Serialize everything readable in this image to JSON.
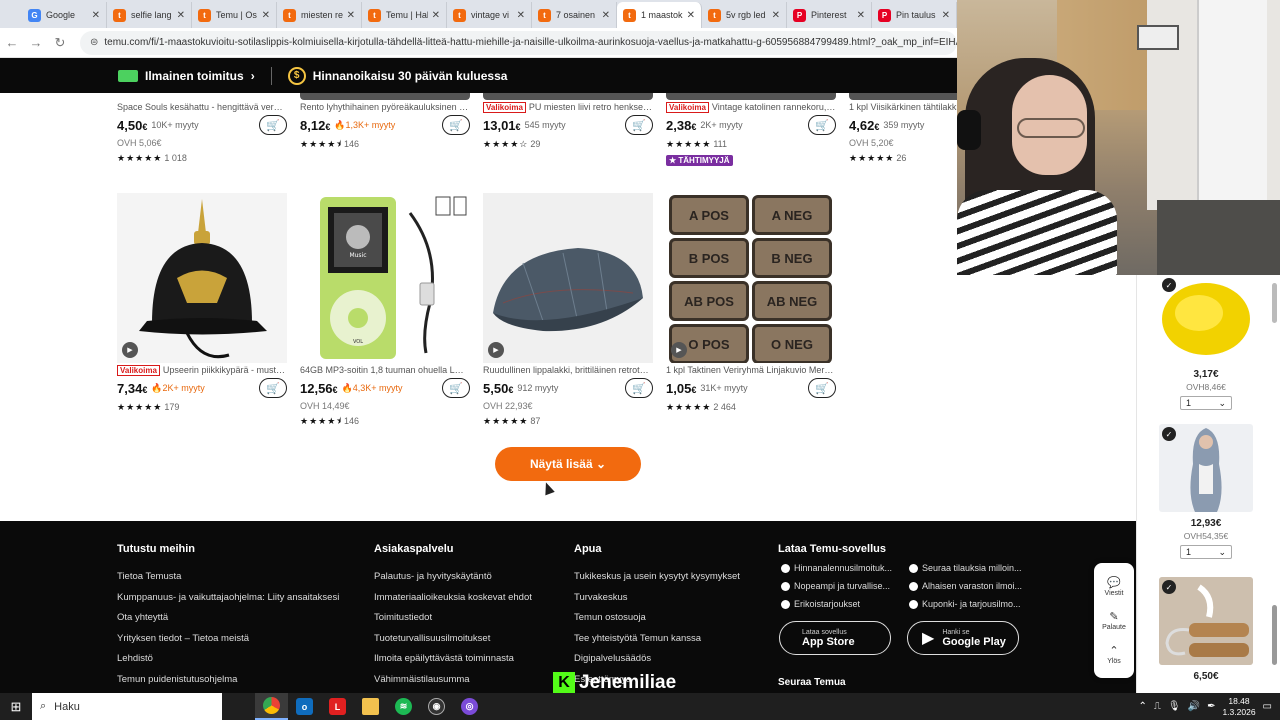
{
  "browser": {
    "tabs": [
      {
        "label": "Google",
        "fav": "G",
        "color": "#4285f4"
      },
      {
        "label": "selfie lang",
        "fav": "t",
        "color": "#f26a0f"
      },
      {
        "label": "Temu | Os",
        "fav": "t",
        "color": "#f26a0f"
      },
      {
        "label": "miesten re",
        "fav": "t",
        "color": "#f26a0f"
      },
      {
        "label": "Temu | Hal",
        "fav": "t",
        "color": "#f26a0f"
      },
      {
        "label": "vintage vi",
        "fav": "t",
        "color": "#f26a0f"
      },
      {
        "label": "7 osainen",
        "fav": "t",
        "color": "#f26a0f"
      },
      {
        "label": "1 maastok",
        "fav": "t",
        "color": "#f26a0f",
        "active": true
      },
      {
        "label": "5v rgb led",
        "fav": "t",
        "color": "#f26a0f"
      },
      {
        "label": "Pinterest",
        "fav": "P",
        "color": "#e60023"
      },
      {
        "label": "Pin taulus",
        "fav": "P",
        "color": "#e60023"
      }
    ],
    "url": "temu.com/fi/1-maastokuvioitu-sotilaslippis-kolmiuisella-kirjotulla-tähdellä-litteä-hattu-miehille-ja-naisille-ulkoilma-aurinkosuoja-vaellus-ja-matkahattu-g-605956884799489.html?_oak_mp_inf=EIHA%2BKbV4"
  },
  "promo": {
    "shipping": "Ilmainen toimitus",
    "shipping_arrow": "›",
    "price_adjust": "Hinnanoikaisu 30 päivän kuluessa",
    "coin": "$"
  },
  "row1": [
    {
      "title": "Space Souls kesähattu - hengittävä verkko...",
      "price_int": "4,50",
      "cur": "€",
      "sold": "10K+ myyty",
      "hot": false,
      "orig": "OVH 5,06€",
      "stars": "★★★★★",
      "count": "1 018",
      "badge": "",
      "star_badge": ""
    },
    {
      "title": "Rento lyhythihainen pyöreäkauluksinen t-p...",
      "price_int": "8,12",
      "cur": "€",
      "sold": "🔥1,3K+ myyty",
      "hot": true,
      "orig": "",
      "stars": "★★★★⯨",
      "count": "146",
      "badge": "",
      "star_badge": ""
    },
    {
      "title": "PU miesten liivi retro henkselit...",
      "price_int": "13,01",
      "cur": "€",
      "sold": "545 myyty",
      "hot": false,
      "orig": "",
      "stars": "★★★★☆",
      "count": "29",
      "badge": "Valikoima",
      "star_badge": ""
    },
    {
      "title": "Vintage katolinen rannekoru, s...",
      "price_int": "2,38",
      "cur": "€",
      "sold": "2K+ myyty",
      "hot": false,
      "orig": "",
      "stars": "★★★★★",
      "count": "111",
      "badge": "Valikoima",
      "star_badge": "★ TÄHTIMYYJÄ"
    },
    {
      "title": "1 kpl Viisikärkinen tähtilakki,...",
      "price_int": "4,62",
      "cur": "€",
      "sold": "359 myyty",
      "hot": false,
      "orig": "OVH 5,20€",
      "stars": "★★★★★",
      "count": "26",
      "badge": "",
      "star_badge": ""
    }
  ],
  "row2": [
    {
      "title": "Upseerin piikkikypärä - musta ...",
      "price_int": "7,34",
      "cur": "€",
      "sold": "🔥2K+ myyty",
      "hot": true,
      "orig": "",
      "stars": "★★★★★",
      "count": "179",
      "badge": "Valikoima"
    },
    {
      "title": "64GB MP3-soitin 1,8 tuuman ohuella LCD-...",
      "price_int": "12,56",
      "cur": "€",
      "sold": "🔥4,3K+ myyty",
      "hot": true,
      "orig": "OVH 14,49€",
      "stars": "★★★★⯨",
      "count": "146",
      "badge": ""
    },
    {
      "title": "Ruudullinen lippalakki, brittiläinen retrotyyl...",
      "price_int": "5,50",
      "cur": "€",
      "sold": "912 myyty",
      "hot": false,
      "orig": "OVH 22,93€",
      "stars": "★★★★★",
      "count": "87",
      "badge": ""
    },
    {
      "title": "1 kpl Taktinen Veriryhmä Linjakuvio Merkki...",
      "price_int": "1,05",
      "cur": "€",
      "sold": "31K+ myyty",
      "hot": false,
      "orig": "",
      "stars": "★★★★★",
      "count": "2 464",
      "badge": ""
    }
  ],
  "patches": [
    "A POS",
    "A NEG",
    "B POS",
    "B NEG",
    "AB POS",
    "AB NEG",
    "O POS",
    "O NEG"
  ],
  "mp3_label": "Music",
  "mp3_vol": "VOL",
  "more_button": "Näytä lisää ⌄",
  "footer": {
    "col1": {
      "title": "Tutustu meihin",
      "links": [
        "Tietoa Temusta",
        "Kumppanuus- ja vaikuttajaohjelma: Liity ansaitaksesi",
        "Ota yhteyttä",
        "Yrityksen tiedot –  Tietoa meistä",
        "Lehdistö",
        "Temun puidenistutusohjelma"
      ]
    },
    "col2": {
      "title": "Asiakaspalvelu",
      "links": [
        "Palautus- ja hyvityskäytäntö",
        "Immateriaalioikeuksia koskevat ehdot",
        "Toimitustiedot",
        "Tuoteturvallisuusilmoitukset",
        "Ilmoita epäilyttävästä toiminnasta",
        "Vähimmäistilausumma"
      ]
    },
    "col3": {
      "title": "Apua",
      "links": [
        "Tukikeskus ja usein kysytyt kysymykset",
        "Turvakeskus",
        "Temun ostosuoja",
        "Tee yhteistyötä Temun kanssa",
        "Digipalvelusäädös",
        "Esteettömyys"
      ]
    },
    "app": {
      "title": "Lataa Temu-sovellus",
      "features": [
        "Hinnanalennusilmoituk...",
        "Seuraa tilauksia milloin...",
        "Nopeampi ja turvallise...",
        "Alhaisen varaston ilmoi...",
        "Erikoistarjoukset",
        "Kuponki- ja tarjousilmo..."
      ],
      "appstore_small": "Lataa sovellus",
      "appstore": "App Store",
      "gplay_small": "Hanki se",
      "gplay": "Google Play"
    },
    "follow": "Seuraa Temua"
  },
  "watermark": {
    "k": "K",
    "name": "Jenemiliae"
  },
  "side_panel": {
    "items": [
      {
        "price": "3,17€",
        "orig": "OVH8,46€",
        "qty": "1"
      },
      {
        "price": "12,93€",
        "orig": "OVH54,35€",
        "qty": "1"
      },
      {
        "price": "6,50€",
        "orig": "",
        "qty": ""
      }
    ]
  },
  "fab": [
    {
      "icon": "💬",
      "label": "Viestit"
    },
    {
      "icon": "✎",
      "label": "Palaute"
    },
    {
      "icon": "⌃",
      "label": "Ylös"
    }
  ],
  "taskbar": {
    "search": "Haku",
    "time": "18.48",
    "date": "1.3.2026"
  }
}
